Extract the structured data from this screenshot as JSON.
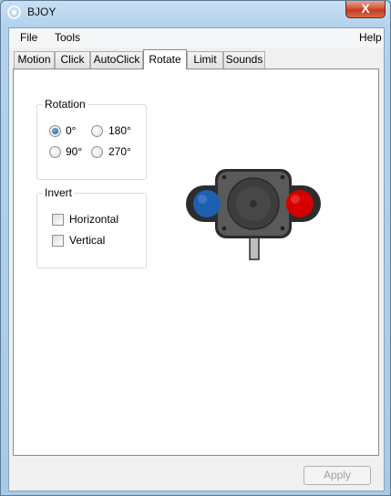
{
  "window": {
    "title": "BJOY",
    "close_label": "X"
  },
  "menu": {
    "file": "File",
    "tools": "Tools",
    "help": "Help"
  },
  "tabs": [
    "Motion",
    "Click",
    "AutoClick",
    "Rotate",
    "Limit",
    "Sounds"
  ],
  "active_tab": "Rotate",
  "rotation": {
    "title": "Rotation",
    "options": [
      "0°",
      "180°",
      "90°",
      "270°"
    ],
    "selected": "0°"
  },
  "invert": {
    "title": "Invert",
    "horizontal_label": "Horizontal",
    "horizontal_checked": false,
    "vertical_label": "Vertical",
    "vertical_checked": false
  },
  "apply_label": "Apply",
  "apply_enabled": false,
  "colors": {
    "left_button": "#1f5fb0",
    "right_button": "#d40000",
    "joystick_body": "#3b3b3b"
  }
}
